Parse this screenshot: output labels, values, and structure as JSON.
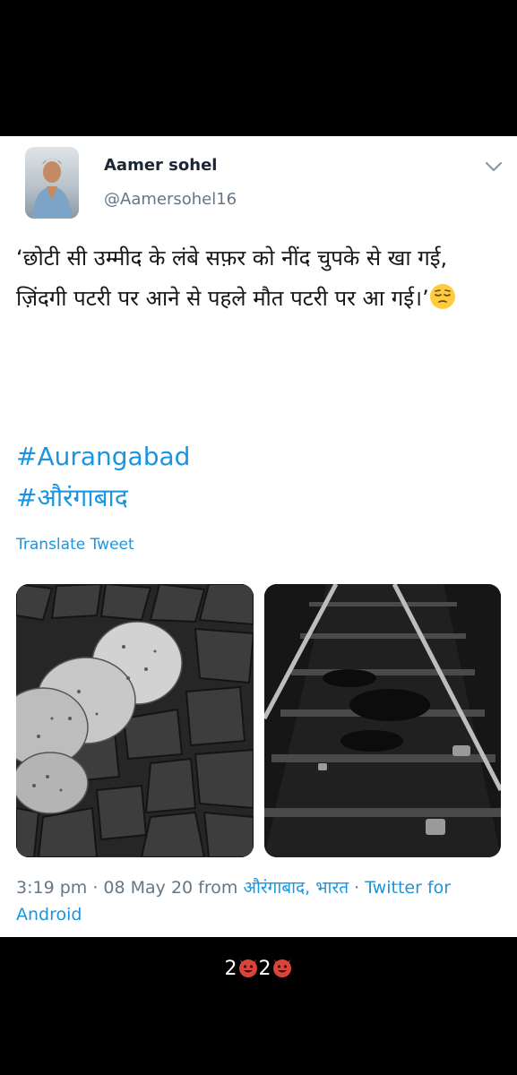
{
  "tweet": {
    "display_name": "Aamer sohel",
    "handle": "@Aamersohel16",
    "text_lines": [
      "‘छोटी सी उम्मीद के लंबे सफ़र को नींद चुपके से खा गई,",
      "ज़िंदगी पटरी पर आने से पहले मौत पटरी पर आ गई।’"
    ],
    "hashtags": [
      "#Aurangabad",
      "#औरंगाबाद"
    ],
    "translate_label": "Translate Tweet",
    "time": "3:19 pm",
    "date": "08 May 20",
    "from_label": "from",
    "location": "औरंगाबाद, भारत",
    "source": "Twitter for Android",
    "separator": " · "
  },
  "footer": {
    "text_a": "2",
    "text_b": "2"
  },
  "colors": {
    "link": "#1b95e0",
    "secondary": "#657786",
    "primary": "#14171a"
  },
  "icons": [
    "chevron-down-icon",
    "pensive-face-emoji",
    "devil-face-emoji"
  ]
}
